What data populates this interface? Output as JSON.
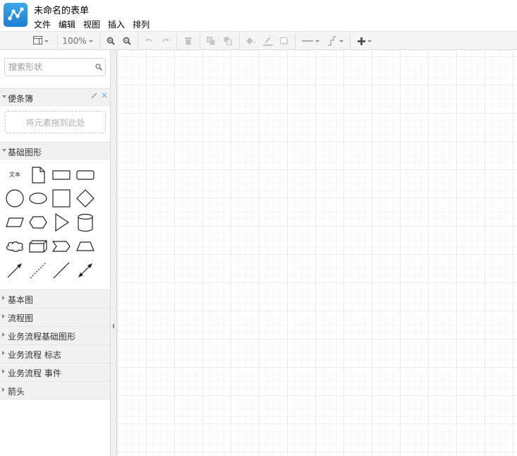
{
  "app": {
    "logo_icon": "diagram-logo-icon",
    "title": "未命名的表单",
    "menu": [
      "文件",
      "编辑",
      "视图",
      "插入",
      "排列"
    ]
  },
  "toolbar": {
    "zoom_level": "100%",
    "icons": [
      "page-view-icon",
      "zoom-in-icon",
      "zoom-out-icon",
      "undo-icon",
      "redo-icon",
      "delete-icon",
      "to-front-icon",
      "to-back-icon",
      "fill-color-icon",
      "line-color-icon",
      "shadow-icon",
      "line-style-icon",
      "waypoint-icon",
      "insert-icon"
    ]
  },
  "sidebar": {
    "search_placeholder": "搜索形状",
    "scratchpad": {
      "label": "便条簿",
      "drop_hint": "将元素拖到此处"
    },
    "basic_shapes": {
      "label": "基础图形",
      "text_shape_label": "文本"
    },
    "libraries": [
      "基本图",
      "流程图",
      "业务流程基础图形",
      "业务流程 标志",
      "业务流程 事件",
      "箭头"
    ]
  }
}
